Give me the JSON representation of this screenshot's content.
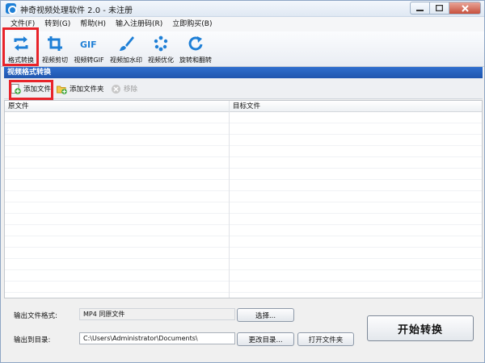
{
  "window": {
    "title": "神奇视频处理软件 2.0 - 未注册"
  },
  "menu": [
    "文件(F)",
    "转到(G)",
    "帮助(H)",
    "输入注册码(R)",
    "立即购买(B)"
  ],
  "toolbar": {
    "tools": [
      {
        "label": "格式转换",
        "icon": "format-convert-icon"
      },
      {
        "label": "视频剪切",
        "icon": "crop-icon"
      },
      {
        "label": "视频转GIF",
        "icon": "gif-icon",
        "icon_text": "GIF"
      },
      {
        "label": "视频加水印",
        "icon": "brush-icon"
      },
      {
        "label": "视频优化",
        "icon": "optimize-icon"
      },
      {
        "label": "旋转和翻转",
        "icon": "rotate-icon"
      }
    ],
    "highlight_color": "#e8232a"
  },
  "section": {
    "title": "视频格式转换"
  },
  "file_actions": {
    "add_file": "添加文件",
    "add_folder": "添加文件夹",
    "remove": "移除"
  },
  "file_list": {
    "columns": [
      "原文件",
      "目标文件"
    ],
    "rows": []
  },
  "output": {
    "format_label": "输出文件格式:",
    "format_value": "MP4 同原文件",
    "select_button": "选择...",
    "dir_label": "输出到目录:",
    "dir_value": "C:\\Users\\Administrator\\Documents\\",
    "change_dir_button": "更改目录...",
    "open_folder_button": "打开文件夹",
    "start_button": "开始转换"
  },
  "colors": {
    "accent": "#1e7fd6",
    "section_header": "#2f6fce"
  }
}
